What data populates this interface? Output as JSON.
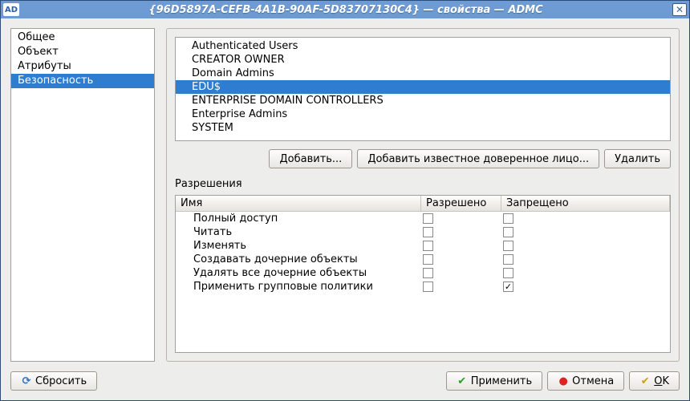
{
  "window": {
    "app_icon_text": "AD",
    "title": "{96D5897A-CEFB-4A1B-90AF-5D83707130C4} — свойства — ADMC"
  },
  "sidebar": {
    "items": [
      {
        "label": "Общее",
        "selected": false
      },
      {
        "label": "Объект",
        "selected": false
      },
      {
        "label": "Атрибуты",
        "selected": false
      },
      {
        "label": "Безопасность",
        "selected": true
      }
    ]
  },
  "principals": {
    "items": [
      {
        "label": "Authenticated Users",
        "selected": false
      },
      {
        "label": "CREATOR OWNER",
        "selected": false
      },
      {
        "label": "Domain Admins",
        "selected": false
      },
      {
        "label": "EDU$",
        "selected": true
      },
      {
        "label": "ENTERPRISE DOMAIN CONTROLLERS",
        "selected": false
      },
      {
        "label": "Enterprise Admins",
        "selected": false
      },
      {
        "label": "SYSTEM",
        "selected": false
      }
    ]
  },
  "buttons": {
    "add": "Добавить...",
    "add_well_known": "Добавить известное доверенное лицо...",
    "remove": "Удалить",
    "reset": "Сбросить",
    "apply": "Применить",
    "cancel": "Отмена",
    "ok": "OK"
  },
  "permissions": {
    "section_label": "Разрешения",
    "columns": {
      "name": "Имя",
      "allow": "Разрешено",
      "deny": "Запрещено"
    },
    "rows": [
      {
        "name": "Полный доступ",
        "allow": false,
        "deny": false
      },
      {
        "name": "Читать",
        "allow": false,
        "deny": false
      },
      {
        "name": "Изменять",
        "allow": false,
        "deny": false
      },
      {
        "name": "Создавать дочерние объекты",
        "allow": false,
        "deny": false
      },
      {
        "name": "Удалять все дочерние объекты",
        "allow": false,
        "deny": false
      },
      {
        "name": "Применить групповые политики",
        "allow": false,
        "deny": true
      }
    ]
  }
}
